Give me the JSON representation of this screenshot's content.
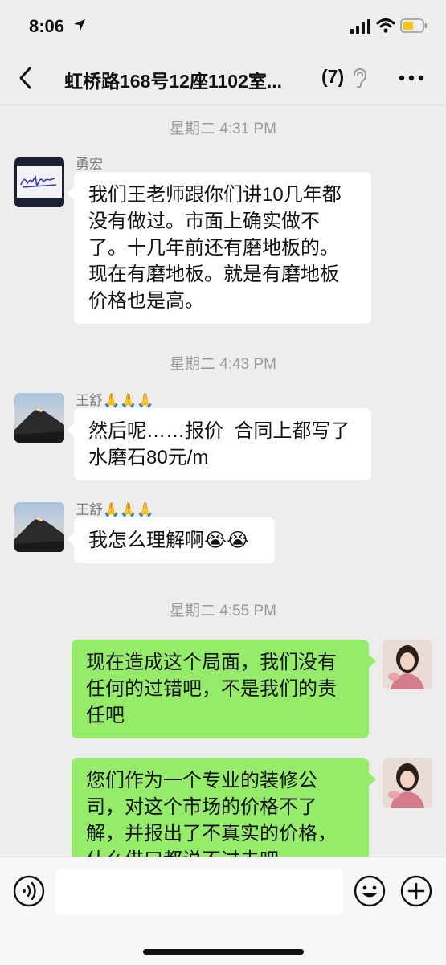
{
  "status_bar": {
    "time": "8:06",
    "location_icon": "location-arrow-icon",
    "signal_icon": "cellular-signal-icon",
    "wifi_icon": "wifi-icon",
    "battery_icon": "battery-icon",
    "battery_color": "#f5c518"
  },
  "nav": {
    "back_icon": "chevron-left-icon",
    "title": "虹桥路168号12座1102室...",
    "member_count": "(7)",
    "earpiece_icon": "ear-icon",
    "more_icon": "more-dots-icon"
  },
  "messages": {
    "ts1": "星期二 4:31 PM",
    "m1": {
      "sender": "勇宏",
      "text": "我们王老师跟你们讲10几年都\n没有做过。市面上确实做不\n了。十几年前还有磨地板的。\n现在有磨地板。就是有磨地板\n价格也是高。"
    },
    "ts2": "星期二 4:43 PM",
    "m2": {
      "sender": "王舒🙏🙏🙏",
      "text": "然后呢……报价  合同上都写了\n水磨石80元/m"
    },
    "m3": {
      "sender": "王舒🙏🙏🙏",
      "text": "我怎么理解啊😭😭"
    },
    "ts3": "星期二 4:55 PM",
    "m4": {
      "text": "现在造成这个局面，我们没有\n任何的过错吧，不是我们的责\n任吧"
    },
    "m5": {
      "text": "您们作为一个专业的装修公\n司，对这个市场的价格不了\n解，并报出了不真实的价格，\n什么借口都说不过去吧"
    }
  },
  "bottom_bar": {
    "voice_icon": "voice-input-icon",
    "emoji_icon": "emoji-icon",
    "plus_icon": "plus-icon",
    "input_value": ""
  },
  "colors": {
    "background": "#ededed",
    "bubble_self": "#95ec69",
    "bubble_other": "#ffffff"
  }
}
